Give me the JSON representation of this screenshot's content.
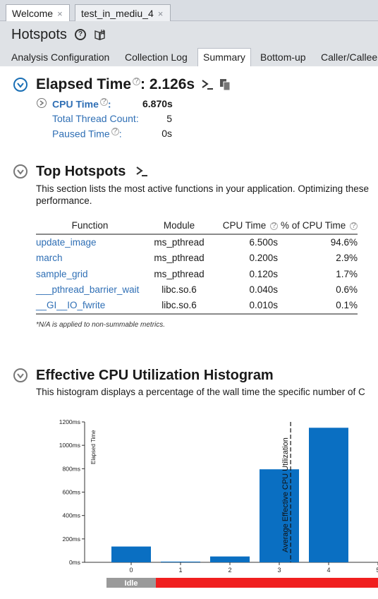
{
  "editor_tabs": [
    {
      "label": "Welcome",
      "close": "×"
    },
    {
      "label": "test_in_mediu_4",
      "close": "×"
    }
  ],
  "header": {
    "title": "Hotspots",
    "help_icon": "?",
    "view_tabs": [
      "Analysis Configuration",
      "Collection Log",
      "Summary",
      "Bottom-up",
      "Caller/Callee"
    ],
    "active_tab": "Summary"
  },
  "elapsed": {
    "label": "Elapsed Time",
    "value": ": 2.126s",
    "metrics": [
      {
        "label": "CPU Time",
        "suffix": ":",
        "value": "6.870s"
      },
      {
        "label": "Total Thread Count:",
        "value": "5"
      },
      {
        "label": "Paused Time",
        "suffix": ":",
        "value": "0s"
      }
    ]
  },
  "top_hotspots": {
    "title": "Top Hotspots",
    "desc_line1": "This section lists the most active functions in your application. Optimizing these",
    "desc_line2": "performance.",
    "columns": [
      "Function",
      "Module",
      "CPU Time",
      "% of CPU Time"
    ],
    "rows": [
      {
        "function": "update_image",
        "module": "ms_pthread",
        "cpu_time": "6.500s",
        "pct": "94.6%"
      },
      {
        "function": "march",
        "module": "ms_pthread",
        "cpu_time": "0.200s",
        "pct": "2.9%"
      },
      {
        "function": "sample_grid",
        "module": "ms_pthread",
        "cpu_time": "0.120s",
        "pct": "1.7%"
      },
      {
        "function": "___pthread_barrier_wait",
        "module": "libc.so.6",
        "cpu_time": "0.040s",
        "pct": "0.6%"
      },
      {
        "function": "__GI__IO_fwrite",
        "module": "libc.so.6",
        "cpu_time": "0.010s",
        "pct": "0.1%"
      }
    ],
    "note": "*N/A is applied to non-summable metrics."
  },
  "histogram": {
    "title": "Effective CPU Utilization Histogram",
    "desc": "This histogram displays a percentage of the wall time the specific number of C"
  },
  "chart_data": {
    "type": "bar",
    "categories": [
      "0",
      "1",
      "2",
      "3",
      "4",
      "5"
    ],
    "values": [
      135,
      5,
      50,
      795,
      1150,
      null
    ],
    "ylabel": "Elapsed Time",
    "ylim": [
      0,
      1200
    ],
    "yticks": [
      "0ms",
      "200ms",
      "400ms",
      "600ms",
      "800ms",
      "1000ms",
      "1200ms"
    ],
    "marker": {
      "label": "Average Effective CPU Utilization",
      "x": 3.23
    },
    "legend_bands": [
      {
        "label": "Idle",
        "color": "#9a9a9a"
      },
      {
        "label": "",
        "color": "#f01f1f"
      }
    ],
    "bar_color": "#0a6fc2"
  }
}
